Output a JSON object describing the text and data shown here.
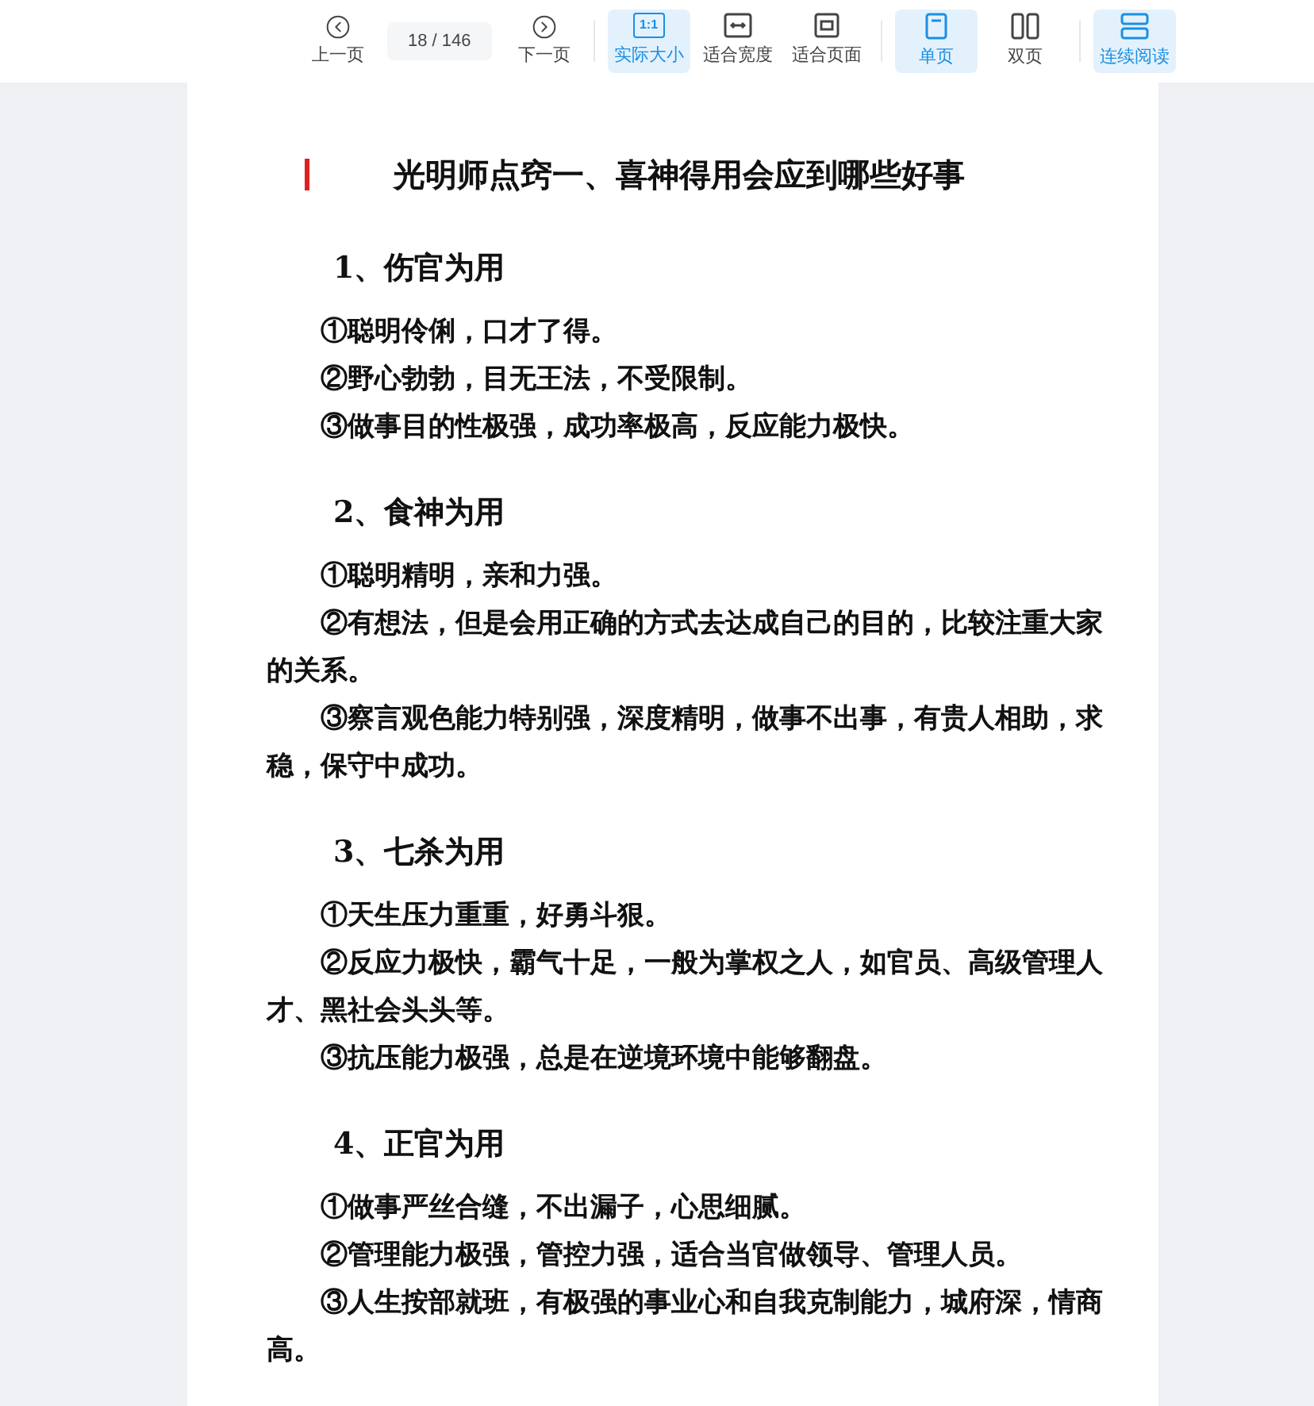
{
  "toolbar": {
    "prev": {
      "label": "上一页"
    },
    "page_indicator": "18 / 146",
    "next": {
      "label": "下一页"
    },
    "groups": [
      [
        {
          "kind": "actual-size",
          "label": "实际大小",
          "icon_text": "1:1",
          "selected": true
        },
        {
          "kind": "fit-width",
          "label": "适合宽度",
          "selected": false
        },
        {
          "kind": "fit-page",
          "label": "适合页面",
          "selected": false
        }
      ],
      [
        {
          "kind": "single",
          "label": "单页",
          "selected": true
        },
        {
          "kind": "double",
          "label": "双页",
          "selected": false
        }
      ],
      [
        {
          "kind": "continuous",
          "label": "连续阅读",
          "selected": true
        }
      ]
    ]
  },
  "document": {
    "title": "光明师点窍一、喜神得用会应到哪些好事",
    "sections": [
      {
        "heading": "1、伤官为用",
        "items": [
          "①聪明伶俐，口才了得。",
          "②野心勃勃，目无王法，不受限制。",
          "③做事目的性极强，成功率极高，反应能力极快。"
        ]
      },
      {
        "heading": "2、食神为用",
        "items": [
          "①聪明精明，亲和力强。",
          "②有想法，但是会用正确的方式去达成自己的目的，比较注重大家的关系。",
          "③察言观色能力特别强，深度精明，做事不出事，有贵人相助，求稳，保守中成功。"
        ]
      },
      {
        "heading": "3、七杀为用",
        "items": [
          "①天生压力重重，好勇斗狠。",
          "②反应力极快，霸气十足，一般为掌权之人，如官员、高级管理人才、黑社会头头等。",
          "③抗压能力极强，总是在逆境环境中能够翻盘。"
        ]
      },
      {
        "heading": "4、正官为用",
        "items": [
          "①做事严丝合缝，不出漏子，心思细腻。",
          "②管理能力极强，管控力强，适合当官做领导、管理人员。",
          "③人生按部就班，有极强的事业心和自我克制能力，城府深，情商高。"
        ]
      }
    ]
  }
}
